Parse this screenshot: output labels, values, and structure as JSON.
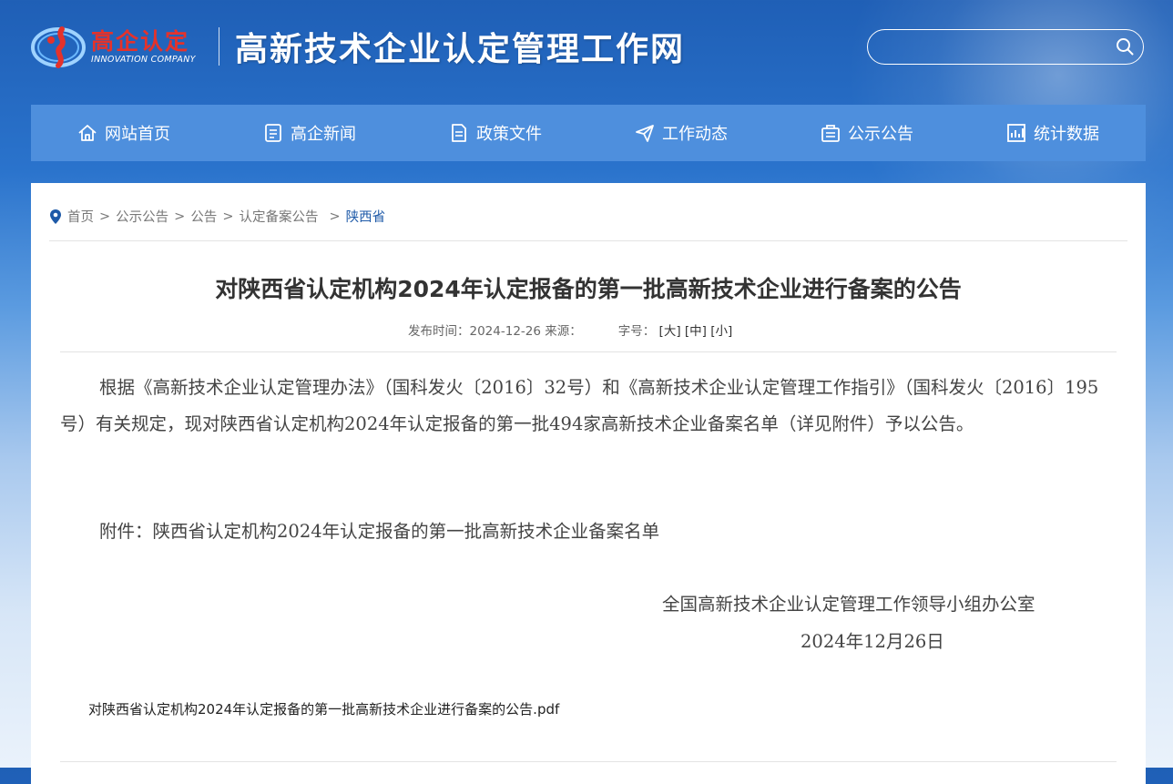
{
  "header": {
    "logo_cn": "高企认定",
    "logo_en": "INNOVATION COMPANY",
    "site_title": "高新技术企业认定管理工作网",
    "search_placeholder": ""
  },
  "nav": [
    {
      "label": "网站首页",
      "icon": "home-icon"
    },
    {
      "label": "高企新闻",
      "icon": "news-icon"
    },
    {
      "label": "政策文件",
      "icon": "document-icon"
    },
    {
      "label": "工作动态",
      "icon": "send-icon"
    },
    {
      "label": "公示公告",
      "icon": "notice-icon"
    },
    {
      "label": "统计数据",
      "icon": "chart-icon"
    }
  ],
  "breadcrumb": {
    "items": [
      "首页",
      "公示公告",
      "公告",
      "认定备案公告"
    ],
    "current": "陕西省",
    "separator": ">"
  },
  "article": {
    "title": "对陕西省认定机构2024年认定报备的第一批高新技术企业进行备案的公告",
    "meta_publish": "发布时间：2024-12-26 来源：",
    "meta_font_label": "字号：",
    "font_large": "[大]",
    "font_medium": "[中]",
    "font_small": "[小]",
    "paragraph": "根据《高新技术企业认定管理办法》（国科发火〔2016〕32号）和《高新技术企业认定管理工作指引》（国科发火〔2016〕195号）有关规定，现对陕西省认定机构2024年认定报备的第一批494家高新技术企业备案名单（详见附件）予以公告。",
    "attachment_line": "附件：陕西省认定机构2024年认定报备的第一批高新技术企业备案名单",
    "signature": "全国高新技术企业认定管理工作领导小组办公室",
    "date": "2024年12月26日",
    "pdf_link": "对陕西省认定机构2024年认定报备的第一批高新技术企业进行备案的公告.pdf"
  },
  "colors": {
    "nav_bg": "#4e8fdd",
    "logo_red": "#e4322b",
    "breadcrumb_current": "#1e5aa8"
  }
}
